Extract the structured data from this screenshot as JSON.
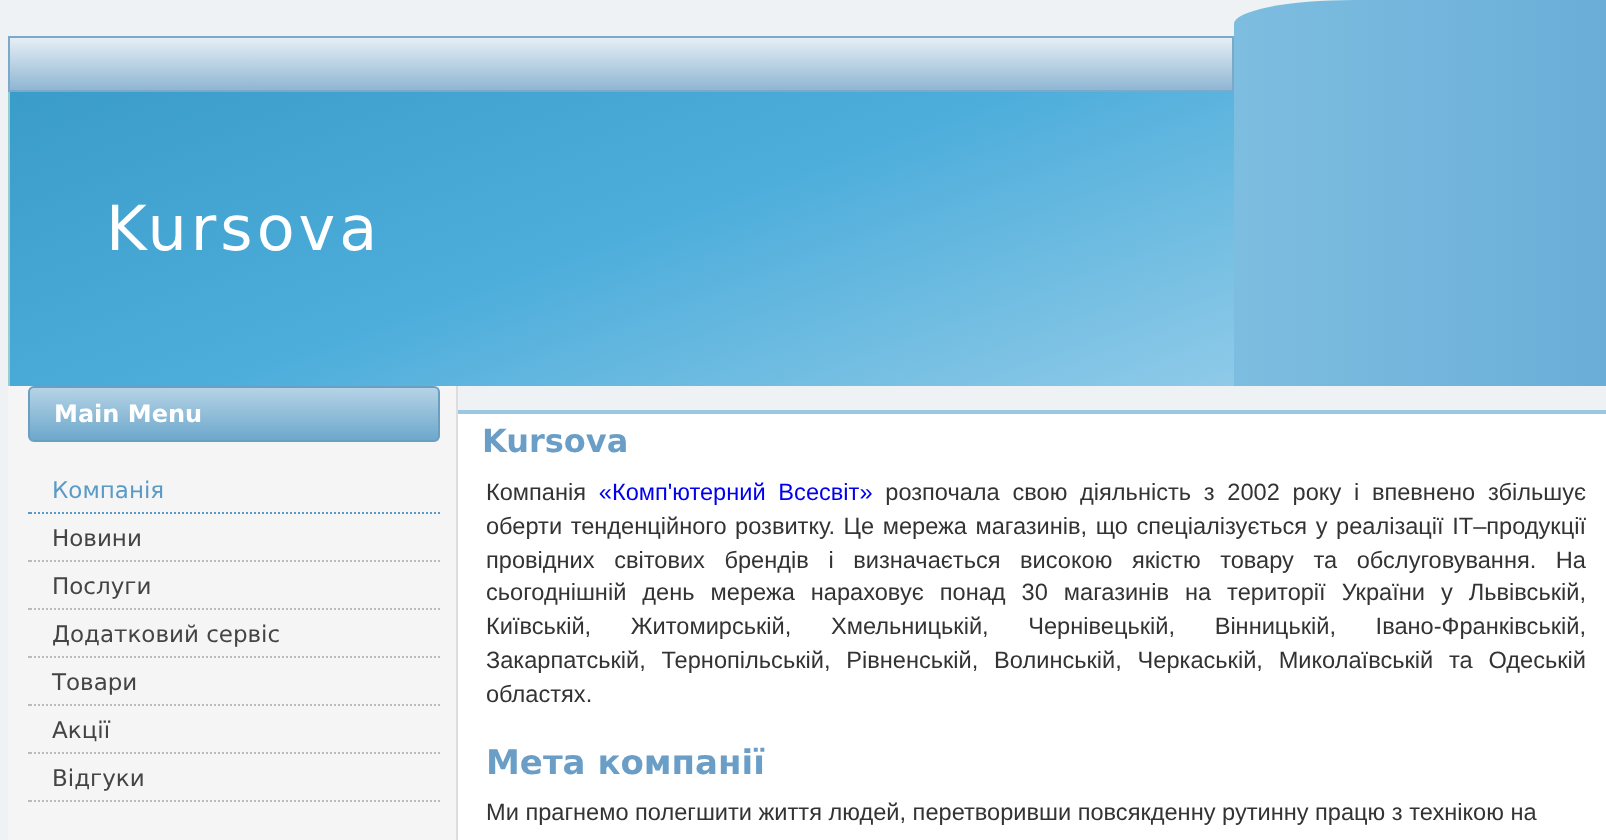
{
  "site_title": "Kursova",
  "main_menu": {
    "title": "Main Menu",
    "items": [
      {
        "label": "Компанія",
        "selected": true
      },
      {
        "label": "Новини",
        "selected": false
      },
      {
        "label": "Послуги",
        "selected": false
      },
      {
        "label": "Додатковий сервіс",
        "selected": false
      },
      {
        "label": "Товари",
        "selected": false
      },
      {
        "label": "Акції",
        "selected": false
      },
      {
        "label": "Відгуки",
        "selected": false
      }
    ]
  },
  "article": {
    "title": "Kursova",
    "intro": {
      "before": "Компанія ",
      "link": "«Комп'ютерний Всесвіт»",
      "after": " розпочала свою діяльність з 2002 року і впевнено збільшує оберти тенденційного розвитку. Це мережа магазинів, що спеціалізується у реалізації IT–продукції провідних світових брендів і визначається високою якістю товару та обслуговування. На сьогоднішній день мережа нараховує понад 30 магазинів на території України у Львівській, Київській, Житомирській, Хмельницькій, Чернівецькій, Вінницькій, Івано-Франківській, Закарпатській, Тернопільській, Рівненській, Волинській, Черкаській, Миколаївській та Одеській областях."
    },
    "section_title": "Мета компанії",
    "section_text": "Ми прагнемо полегшити життя людей, перетворивши повсякденну рутинну працю з технікою на"
  }
}
